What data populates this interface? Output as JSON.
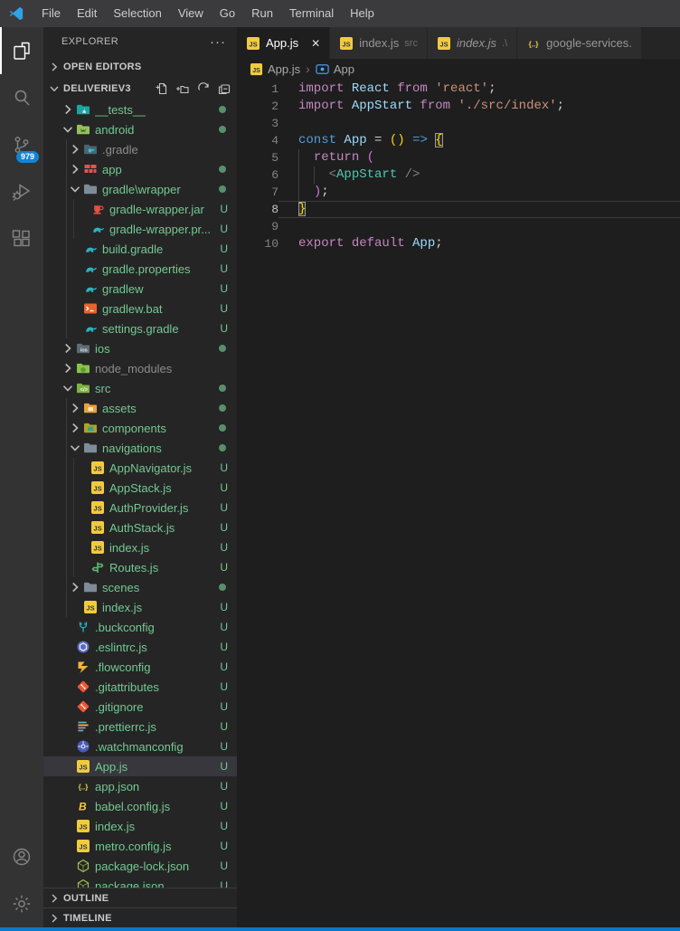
{
  "window": {
    "menus": [
      "File",
      "Edit",
      "Selection",
      "View",
      "Go",
      "Run",
      "Terminal",
      "Help"
    ]
  },
  "activity_bar": {
    "items": [
      {
        "id": "explorer",
        "active": true
      },
      {
        "id": "search",
        "active": false
      },
      {
        "id": "source-control",
        "active": false,
        "badge": "979"
      },
      {
        "id": "run-debug",
        "active": false
      },
      {
        "id": "extensions",
        "active": false
      }
    ],
    "bottom_items": [
      {
        "id": "account"
      },
      {
        "id": "settings"
      }
    ]
  },
  "sidebar": {
    "title": "EXPLORER",
    "more_label": "···",
    "open_editors_label": "OPEN EDITORS",
    "project_label": "DELIVERIEV3",
    "outline_label": "OUTLINE",
    "timeline_label": "TIMELINE",
    "tree": [
      {
        "label": "__tests__",
        "level": 0,
        "icon": "folder-test",
        "expand": "closed",
        "badge": "dot"
      },
      {
        "label": "android",
        "level": 0,
        "icon": "folder-android",
        "expand": "open",
        "badge": "dot"
      },
      {
        "label": ".gradle",
        "level": 1,
        "icon": "folder-gradle",
        "expand": "closed",
        "dim": true
      },
      {
        "label": "app",
        "level": 1,
        "icon": "folder-app",
        "expand": "closed",
        "badge": "dot"
      },
      {
        "label": "gradle\\wrapper",
        "level": 1,
        "icon": "folder",
        "expand": "open",
        "badge": "dot"
      },
      {
        "label": "gradle-wrapper.jar",
        "level": 2,
        "icon": "jar",
        "badge": "U"
      },
      {
        "label": "gradle-wrapper.pr...",
        "level": 2,
        "icon": "gradle",
        "badge": "U"
      },
      {
        "label": "build.gradle",
        "level": 1,
        "icon": "gradle",
        "badge": "U"
      },
      {
        "label": "gradle.properties",
        "level": 1,
        "icon": "gradle",
        "badge": "U"
      },
      {
        "label": "gradlew",
        "level": 1,
        "icon": "gradle",
        "badge": "U"
      },
      {
        "label": "gradlew.bat",
        "level": 1,
        "icon": "bat",
        "badge": "U"
      },
      {
        "label": "settings.gradle",
        "level": 1,
        "icon": "gradle",
        "badge": "U"
      },
      {
        "label": "ios",
        "level": 0,
        "icon": "folder-ios",
        "expand": "closed",
        "badge": "dot"
      },
      {
        "label": "node_modules",
        "level": 0,
        "icon": "folder-node",
        "expand": "closed",
        "dim": true
      },
      {
        "label": "src",
        "level": 0,
        "icon": "folder-src",
        "expand": "open",
        "badge": "dot"
      },
      {
        "label": "assets",
        "level": 1,
        "icon": "folder-assets",
        "expand": "closed",
        "badge": "dot"
      },
      {
        "label": "components",
        "level": 1,
        "icon": "folder-components",
        "expand": "closed",
        "badge": "dot"
      },
      {
        "label": "navigations",
        "level": 1,
        "icon": "folder",
        "expand": "open",
        "badge": "dot"
      },
      {
        "label": "AppNavigator.js",
        "level": 2,
        "icon": "js",
        "badge": "U"
      },
      {
        "label": "AppStack.js",
        "level": 2,
        "icon": "js",
        "badge": "U"
      },
      {
        "label": "AuthProvider.js",
        "level": 2,
        "icon": "js",
        "badge": "U"
      },
      {
        "label": "AuthStack.js",
        "level": 2,
        "icon": "js",
        "badge": "U"
      },
      {
        "label": "index.js",
        "level": 2,
        "icon": "js",
        "badge": "U"
      },
      {
        "label": "Routes.js",
        "level": 2,
        "icon": "routes",
        "badge": "U"
      },
      {
        "label": "scenes",
        "level": 1,
        "icon": "folder",
        "expand": "closed",
        "badge": "dot"
      },
      {
        "label": "index.js",
        "level": 1,
        "icon": "js",
        "badge": "U"
      },
      {
        "label": ".buckconfig",
        "level": 0,
        "icon": "buck",
        "badge": "U"
      },
      {
        "label": ".eslintrc.js",
        "level": 0,
        "icon": "eslint",
        "badge": "U"
      },
      {
        "label": ".flowconfig",
        "level": 0,
        "icon": "flow",
        "badge": "U"
      },
      {
        "label": ".gitattributes",
        "level": 0,
        "icon": "git",
        "badge": "U"
      },
      {
        "label": ".gitignore",
        "level": 0,
        "icon": "git",
        "badge": "U"
      },
      {
        "label": ".prettierrc.js",
        "level": 0,
        "icon": "prettier",
        "badge": "U"
      },
      {
        "label": ".watchmanconfig",
        "level": 0,
        "icon": "watchman",
        "badge": "U"
      },
      {
        "label": "App.js",
        "level": 0,
        "icon": "js",
        "badge": "U",
        "selected": true
      },
      {
        "label": "app.json",
        "level": 0,
        "icon": "json",
        "badge": "U"
      },
      {
        "label": "babel.config.js",
        "level": 0,
        "icon": "babel",
        "badge": "U"
      },
      {
        "label": "index.js",
        "level": 0,
        "icon": "js",
        "badge": "U"
      },
      {
        "label": "metro.config.js",
        "level": 0,
        "icon": "js",
        "badge": "U"
      },
      {
        "label": "package-lock.json",
        "level": 0,
        "icon": "npm",
        "badge": "U"
      },
      {
        "label": "package.json",
        "level": 0,
        "icon": "npm",
        "badge": "U"
      }
    ]
  },
  "editor": {
    "tabs": [
      {
        "label": "App.js",
        "icon": "js",
        "active": true,
        "close": "✕"
      },
      {
        "label": "index.js",
        "icon": "js",
        "desc": "src"
      },
      {
        "label": "index.js",
        "icon": "js",
        "desc": ".\\",
        "italic": true
      },
      {
        "label": "google-services.",
        "icon": "json"
      }
    ],
    "breadcrumb": {
      "file": "App.js",
      "separator": "›",
      "symbol": "App"
    },
    "code": [
      {
        "n": "1",
        "tokens": [
          [
            "k",
            "import "
          ],
          [
            "v",
            "React"
          ],
          [
            "k",
            " from "
          ],
          [
            "s",
            "'react'"
          ],
          [
            "p",
            ";"
          ]
        ]
      },
      {
        "n": "2",
        "tokens": [
          [
            "k",
            "import "
          ],
          [
            "v",
            "AppStart"
          ],
          [
            "k",
            " from "
          ],
          [
            "s",
            "'./src/index'"
          ],
          [
            "p",
            ";"
          ]
        ]
      },
      {
        "n": "3",
        "tokens": []
      },
      {
        "n": "4",
        "tokens": [
          [
            "c",
            "const "
          ],
          [
            "v",
            "App"
          ],
          [
            "p",
            " = "
          ],
          [
            "g",
            "()"
          ],
          [
            "p",
            " "
          ],
          [
            "c",
            "=>"
          ],
          [
            "p",
            " "
          ],
          [
            "m",
            "{"
          ]
        ]
      },
      {
        "n": "5",
        "guides": [
          0
        ],
        "tokens": [
          [
            "p",
            "  "
          ],
          [
            "k",
            "return"
          ],
          [
            "p",
            " "
          ],
          [
            "q",
            "("
          ]
        ]
      },
      {
        "n": "6",
        "guides": [
          0,
          2
        ],
        "tokens": [
          [
            "p",
            "    "
          ],
          [
            "d",
            "<"
          ],
          [
            "t",
            "AppStart"
          ],
          [
            "d",
            " />"
          ]
        ]
      },
      {
        "n": "7",
        "guides": [
          0
        ],
        "tokens": [
          [
            "p",
            "  "
          ],
          [
            "q",
            ")"
          ],
          [
            "p",
            ";"
          ]
        ]
      },
      {
        "n": "8",
        "current": true,
        "tokens": [
          [
            "m",
            "}"
          ]
        ]
      },
      {
        "n": "9",
        "tokens": []
      },
      {
        "n": "10",
        "tokens": [
          [
            "k",
            "export "
          ],
          [
            "k",
            "default "
          ],
          [
            "v",
            "App"
          ],
          [
            "p",
            ";"
          ]
        ]
      }
    ]
  },
  "status_bar": {
    "color": "#0a79cc"
  }
}
